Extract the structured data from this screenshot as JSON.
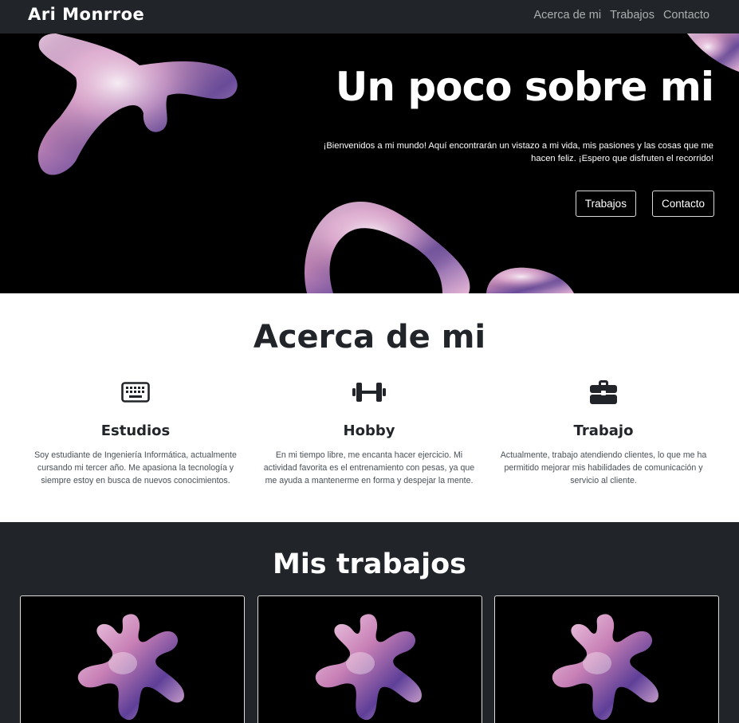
{
  "navbar": {
    "brand": "Ari Monrroe",
    "links": [
      "Acerca de mi",
      "Trabajos",
      "Contacto"
    ]
  },
  "hero": {
    "title": "Un poco sobre mi",
    "text_line1": "¡Bienvenidos a mi mundo! Aquí encontrarán un vistazo a mi vida, mis pasiones y las cosas que me",
    "text_line2": "hacen feliz. ¡Espero que disfruten el recorrido!",
    "buttons": [
      "Trabajos",
      "Contacto"
    ]
  },
  "about": {
    "title": "Acerca de mi",
    "columns": [
      {
        "icon": "keyboard-icon",
        "heading": "Estudios",
        "line1": "Soy estudiante de Ingeniería Informática, actualmente",
        "line2": "cursando mi tercer año. Me apasiona la tecnología y",
        "line3": "siempre estoy en busca de nuevos conocimientos."
      },
      {
        "icon": "dumbbell-icon",
        "heading": "Hobby",
        "line1": "En mi tiempo libre, me encanta hacer ejercicio. Mi",
        "line2": "actividad favorita es el entrenamiento con pesas, ya que",
        "line3": "me ayuda a mantenerme en forma y despejar la mente."
      },
      {
        "icon": "briefcase-icon",
        "heading": "Trabajo",
        "line1": "Actualmente, trabajo atendiendo clientes, lo que me ha",
        "line2": "permitido mejorar mis habilidades de comunicación y",
        "line3": "servicio al cliente."
      }
    ]
  },
  "works": {
    "title": "Mis trabajos"
  },
  "colors": {
    "navbar_bg": "#212529",
    "hero_bg": "#000000",
    "blob_pink": "#d9a6c8",
    "blob_purple": "#5b3a8a"
  }
}
